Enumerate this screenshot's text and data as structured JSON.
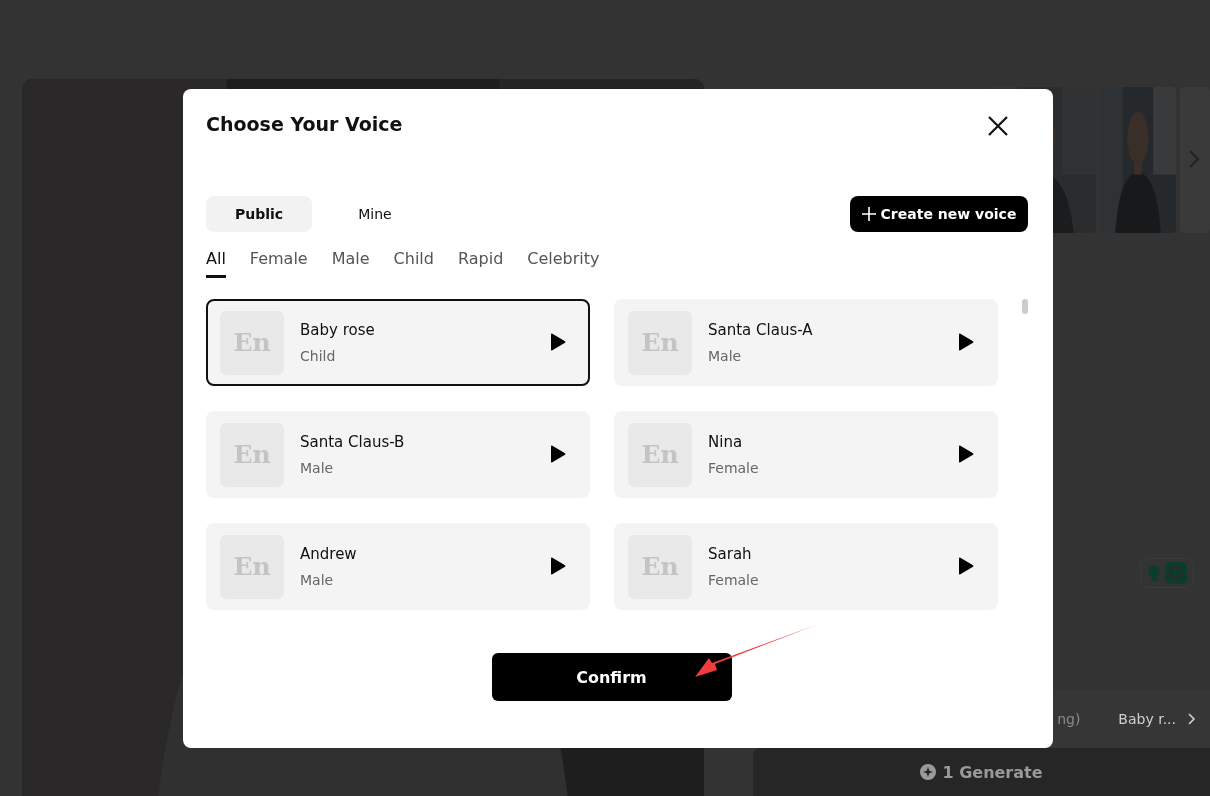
{
  "background": {
    "settings_value": "ng)",
    "voice_value": "Baby r...",
    "generate_button": "1 Generate"
  },
  "dialog": {
    "title": "Choose Your Voice",
    "source_tabs": [
      {
        "label": "Public",
        "selected": true
      },
      {
        "label": "Mine",
        "selected": false
      }
    ],
    "create_button": "Create new voice",
    "filters": [
      {
        "label": "All",
        "selected": true
      },
      {
        "label": "Female",
        "selected": false
      },
      {
        "label": "Male",
        "selected": false
      },
      {
        "label": "Child",
        "selected": false
      },
      {
        "label": "Rapid",
        "selected": false
      },
      {
        "label": "Celebrity",
        "selected": false
      }
    ],
    "voices": [
      {
        "avatar": "En",
        "name": "Baby rose",
        "category": "Child",
        "selected": true
      },
      {
        "avatar": "En",
        "name": "Santa Claus-A",
        "category": "Male",
        "selected": false
      },
      {
        "avatar": "En",
        "name": "Santa Claus-B",
        "category": "Male",
        "selected": false
      },
      {
        "avatar": "En",
        "name": "Nina",
        "category": "Female",
        "selected": false
      },
      {
        "avatar": "En",
        "name": "Andrew",
        "category": "Male",
        "selected": false
      },
      {
        "avatar": "En",
        "name": "Sarah",
        "category": "Female",
        "selected": false
      }
    ],
    "confirm_button": "Confirm"
  }
}
